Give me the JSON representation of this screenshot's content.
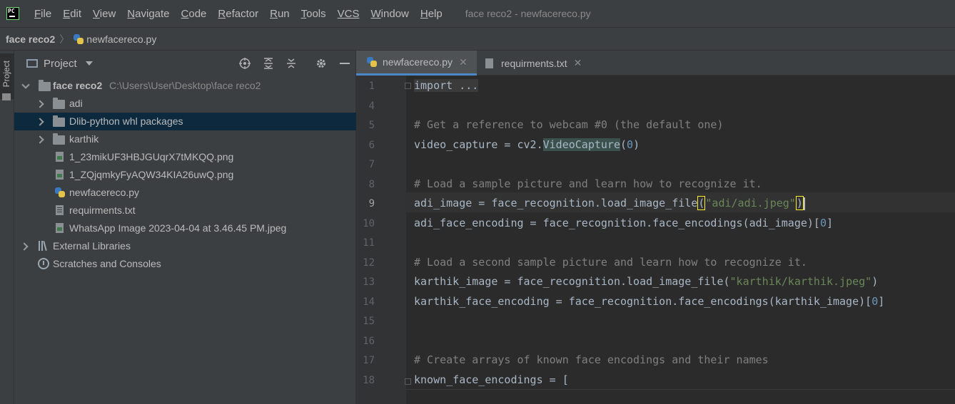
{
  "menubar": {
    "logo_text": "PC",
    "items": [
      {
        "u": "F",
        "rest": "ile"
      },
      {
        "u": "E",
        "rest": "dit"
      },
      {
        "u": "V",
        "rest": "iew"
      },
      {
        "u": "N",
        "rest": "avigate"
      },
      {
        "u": "C",
        "rest": "ode"
      },
      {
        "u": "R",
        "rest": "efactor"
      },
      {
        "u": "R",
        "rest": "un"
      },
      {
        "u": "T",
        "rest": "ools"
      },
      {
        "u": "VCS",
        "rest": ""
      },
      {
        "u": "W",
        "rest": "indow"
      },
      {
        "u": "H",
        "rest": "elp"
      }
    ],
    "window_title": "face reco2 - newfacereco.py"
  },
  "breadcrumb": {
    "root": "face reco2",
    "file": "newfacereco.py"
  },
  "left_strip": {
    "tab_label": "Project"
  },
  "project_panel": {
    "title": "Project",
    "tree": [
      {
        "label": "face reco2",
        "path": "C:\\Users\\User\\Desktop\\face reco2",
        "kind": "folder",
        "expanded": true
      },
      {
        "label": "adi",
        "kind": "folder",
        "expanded": false
      },
      {
        "label": "Dlib-python whl packages",
        "kind": "folder",
        "expanded": false,
        "selected": true
      },
      {
        "label": "karthik",
        "kind": "folder",
        "expanded": false
      },
      {
        "label": "1_23mikUF3HBJGUqrX7tMKQQ.png",
        "kind": "image"
      },
      {
        "label": "1_ZQjqmkyFyAQW34KIA26uwQ.png",
        "kind": "image"
      },
      {
        "label": "newfacereco.py",
        "kind": "python"
      },
      {
        "label": "requirments.txt",
        "kind": "text"
      },
      {
        "label": "WhatsApp Image 2023-04-04 at 3.46.45 PM.jpeg",
        "kind": "image"
      },
      {
        "label": "External Libraries",
        "kind": "libraries"
      },
      {
        "label": "Scratches and Consoles",
        "kind": "scratches"
      }
    ]
  },
  "editor": {
    "tabs": [
      {
        "label": "newfacereco.py",
        "active": true
      },
      {
        "label": "requirments.txt",
        "active": false
      }
    ],
    "line_numbers": [
      "1",
      "4",
      "5",
      "6",
      "7",
      "8",
      "9",
      "10",
      "11",
      "12",
      "13",
      "14",
      "15",
      "16",
      "17",
      "18"
    ],
    "current_line": "9",
    "lines": {
      "l1": "import ...",
      "l5": "# Get a reference to webcam #0 (the default one)",
      "l6_a": "video_capture = cv2.",
      "l6_b": "VideoCapture",
      "l6_c": "(",
      "l6_d": "0",
      "l6_e": ")",
      "l8": "# Load a sample picture and learn how to recognize it.",
      "l9_a": "adi_image = face_recognition.load_image_file",
      "l9_b": "(",
      "l9_c": "\"adi/adi.jpeg\"",
      "l9_d": ")",
      "l10_a": "adi_face_encoding = face_recognition.face_encodings(adi_image)[",
      "l10_b": "0",
      "l10_c": "]",
      "l12": "# Load a second sample picture and learn how to recognize it.",
      "l13_a": "karthik_image = face_recognition.load_image_file(",
      "l13_b": "\"karthik/karthik.jpeg\"",
      "l13_c": ")",
      "l14_a": "karthik_face_encoding = face_recognition.face_encodings(karthik_image)[",
      "l14_b": "0",
      "l14_c": "]",
      "l17": "# Create arrays of known face encodings and their names",
      "l18": "known_face_encodings = ["
    }
  },
  "colors": {
    "background": "#2b2b2b",
    "panel": "#3c3f41",
    "selection": "#0d293e",
    "comment": "#808080",
    "string": "#6a8759",
    "number": "#6897bb",
    "accent": "#4a88c7"
  }
}
